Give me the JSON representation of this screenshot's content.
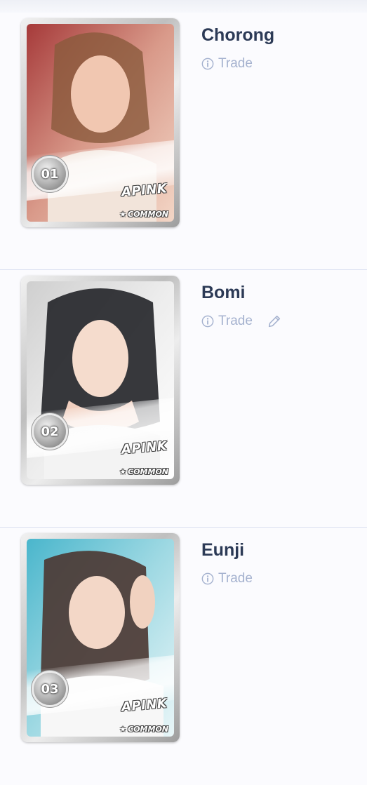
{
  "cards": [
    {
      "name": "Chorong",
      "number": "01",
      "group": "APINK",
      "rarity": "COMMON",
      "trade_label": "Trade",
      "editable": false,
      "bg_colors": [
        "#a63a3a",
        "#d99a8a",
        "#f3d6c6"
      ]
    },
    {
      "name": "Bomi",
      "number": "02",
      "group": "APINK",
      "rarity": "COMMON",
      "trade_label": "Trade",
      "editable": true,
      "bg_colors": [
        "#cfcfcf",
        "#ededed",
        "#ffffff"
      ]
    },
    {
      "name": "Eunji",
      "number": "03",
      "group": "APINK",
      "rarity": "COMMON",
      "trade_label": "Trade",
      "editable": false,
      "bg_colors": [
        "#4ab6cc",
        "#9fd9e3",
        "#e9f6f8"
      ]
    }
  ],
  "icons": {
    "info": "info-circle-icon",
    "edit": "pencil-icon",
    "rarity": "star-icon"
  },
  "colors": {
    "name_text": "#2c3a56",
    "action_text": "#a5b2cf",
    "divider": "#d9dff0"
  }
}
